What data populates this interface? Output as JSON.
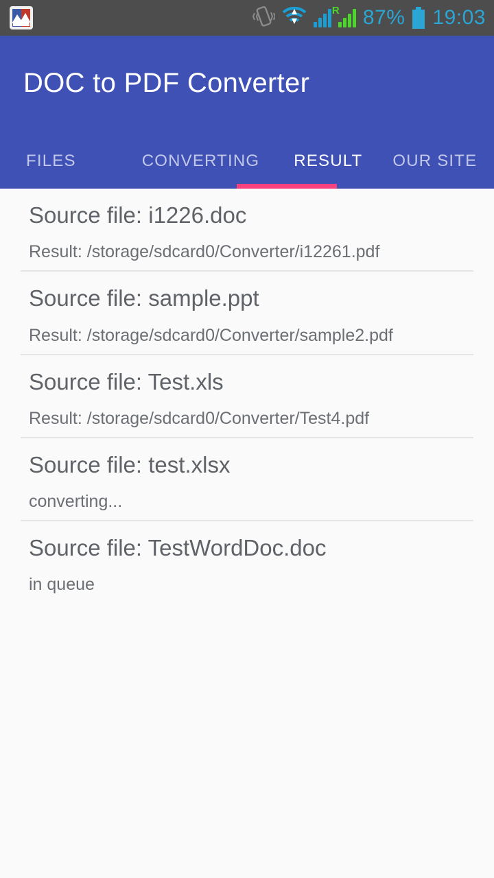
{
  "status_bar": {
    "notification_icon": "chart-app-icon",
    "vibrate_icon": "vibrate-icon",
    "wifi_icon": "wifi-icon",
    "signal_sim1_icon": "signal-bars-icon",
    "signal_sim2_icon": "signal-bars-roaming-icon",
    "roaming_label": "R",
    "battery_percent": "87%",
    "battery_icon": "battery-full-icon",
    "clock": "19:03",
    "accent_color": "#2ba5d4",
    "background_color": "#4d4d4d"
  },
  "app_bar": {
    "title": "DOC to PDF Converter",
    "background_color": "#3f51b5",
    "indicator_color": "#f8417f",
    "tabs": [
      {
        "label": "FILES",
        "active": false
      },
      {
        "label": "CONVERTING",
        "active": false
      },
      {
        "label": "RESULT",
        "active": true
      },
      {
        "label": "OUR SITE",
        "active": false
      }
    ]
  },
  "main": {
    "background_color": "#fafafa",
    "items": [
      {
        "source": "Source file: i1226.doc",
        "status": "Result: /storage/sdcard0/Converter/i12261.pdf"
      },
      {
        "source": "Source file: sample.ppt",
        "status": "Result: /storage/sdcard0/Converter/sample2.pdf"
      },
      {
        "source": "Source file: Test.xls",
        "status": "Result: /storage/sdcard0/Converter/Test4.pdf"
      },
      {
        "source": "Source file: test.xlsx",
        "status": "converting..."
      },
      {
        "source": "Source file: TestWordDoc.doc",
        "status": "in queue"
      }
    ]
  }
}
